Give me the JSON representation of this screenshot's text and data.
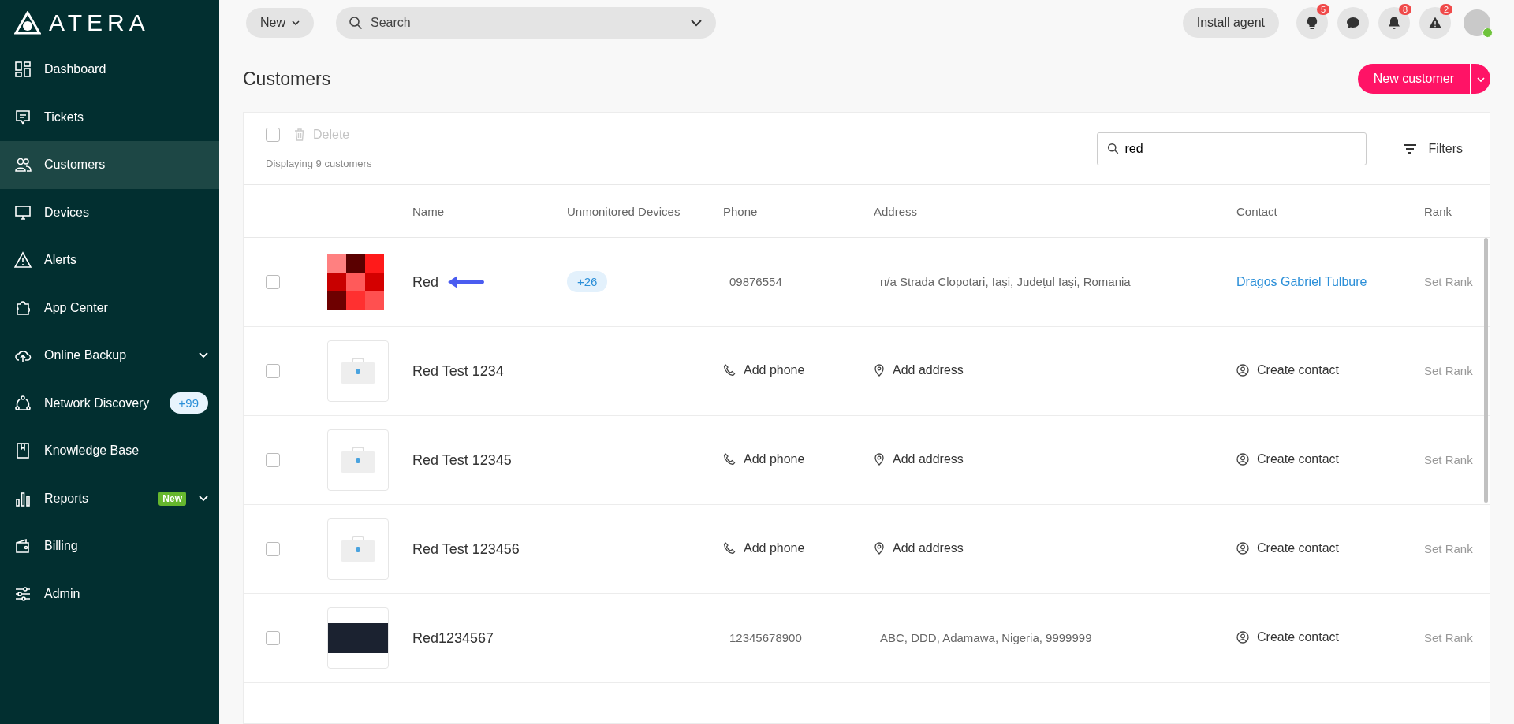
{
  "sidebar": {
    "logo": "ATERA",
    "items": [
      {
        "label": "Dashboard",
        "selected": false
      },
      {
        "label": "Tickets",
        "selected": false
      },
      {
        "label": "Customers",
        "selected": true
      },
      {
        "label": "Devices",
        "selected": false
      },
      {
        "label": "Alerts",
        "selected": false
      },
      {
        "label": "App Center",
        "selected": false
      },
      {
        "label": "Online Backup",
        "selected": false,
        "expandable": true
      },
      {
        "label": "Network Discovery",
        "selected": false,
        "count": "+99"
      },
      {
        "label": "Knowledge Base",
        "selected": false
      },
      {
        "label": "Reports",
        "selected": false,
        "tag": "New",
        "expandable": true
      },
      {
        "label": "Billing",
        "selected": false
      },
      {
        "label": "Admin",
        "selected": false
      }
    ]
  },
  "topbar": {
    "new_button": "New",
    "search": {
      "placeholder": "Search"
    },
    "install_button": "Install agent",
    "icons": [
      {
        "kind": "bulb",
        "badge": "5"
      },
      {
        "kind": "chat"
      },
      {
        "kind": "bell",
        "badge": "8"
      },
      {
        "kind": "alert",
        "badge": "2"
      }
    ]
  },
  "page": {
    "title": "Customers",
    "new_customer_button": "New customer"
  },
  "toolbar": {
    "select_all_checked": false,
    "delete": "Delete",
    "count": "Displaying 9 customers",
    "search_value": "red",
    "filters": "Filters"
  },
  "table": {
    "columns": [
      "Name",
      "Unmonitored Devices",
      "Phone",
      "Address",
      "Contact",
      "Rank"
    ],
    "rows": [
      {
        "kind": "grid",
        "name": "Red",
        "arrow": true,
        "checked": false,
        "unmonitored": "+26",
        "phone": {
          "kind": "value",
          "text": "09876554"
        },
        "address": {
          "kind": "value",
          "text": "n/a Strada Clopotari, Iași, Județul Iași, Romania"
        },
        "contact": {
          "kind": "link",
          "text": "Dragos Gabriel Tulbure"
        },
        "rank": "Set Rank"
      },
      {
        "kind": "briefcase",
        "name": "Red Test 1234",
        "checked": false,
        "phone": {
          "kind": "action",
          "text": "Add phone"
        },
        "address": {
          "kind": "action",
          "text": "Add address"
        },
        "contact": {
          "kind": "action",
          "text": "Create contact"
        },
        "rank": "Set Rank"
      },
      {
        "kind": "briefcase",
        "name": "Red Test 12345",
        "checked": false,
        "phone": {
          "kind": "action",
          "text": "Add phone"
        },
        "address": {
          "kind": "action",
          "text": "Add address"
        },
        "contact": {
          "kind": "action",
          "text": "Create contact"
        },
        "rank": "Set Rank"
      },
      {
        "kind": "briefcase",
        "name": "Red Test 123456",
        "checked": false,
        "phone": {
          "kind": "action",
          "text": "Add phone"
        },
        "address": {
          "kind": "action",
          "text": "Add address"
        },
        "contact": {
          "kind": "action",
          "text": "Create contact"
        },
        "rank": "Set Rank"
      },
      {
        "kind": "photo",
        "name": "Red1234567",
        "checked": false,
        "phone": {
          "kind": "value",
          "text": "12345678900"
        },
        "address": {
          "kind": "value",
          "text": "ABC, DDD, Adamawa, Nigeria, 9999999"
        },
        "contact": {
          "kind": "action",
          "text": "Create contact"
        },
        "rank": "Set Rank"
      }
    ]
  }
}
